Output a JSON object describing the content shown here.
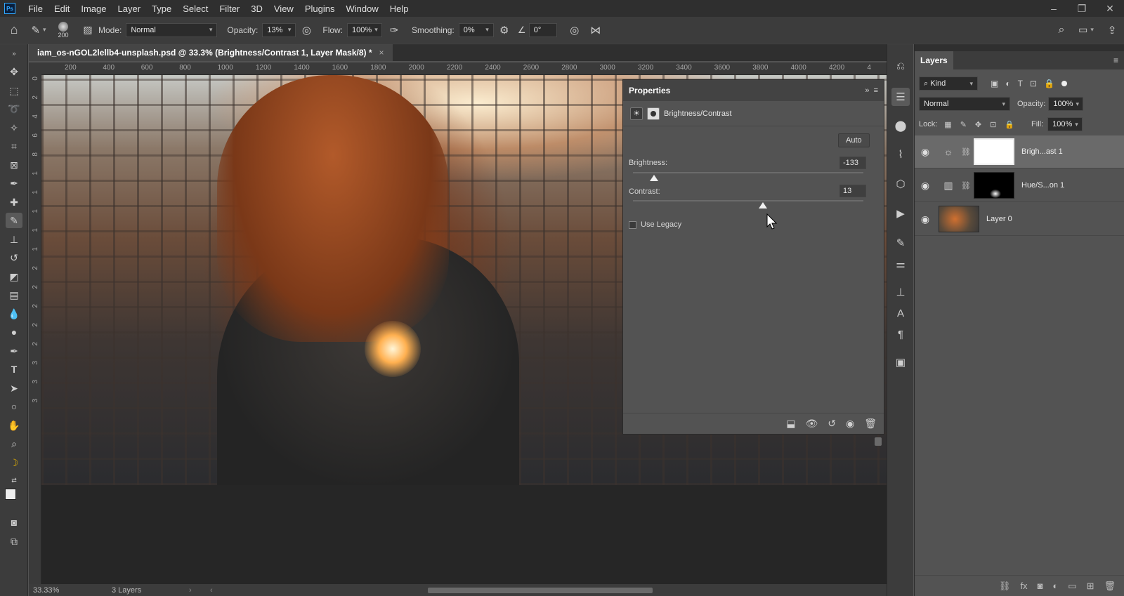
{
  "menubar": {
    "logo": "Ps",
    "items": [
      "File",
      "Edit",
      "Image",
      "Layer",
      "Type",
      "Select",
      "Filter",
      "3D",
      "View",
      "Plugins",
      "Window",
      "Help"
    ]
  },
  "options": {
    "brush_size": "200",
    "mode_label": "Mode:",
    "mode_value": "Normal",
    "opacity_label": "Opacity:",
    "opacity_value": "13%",
    "flow_label": "Flow:",
    "flow_value": "100%",
    "smoothing_label": "Smoothing:",
    "smoothing_value": "0%",
    "angle_value": "0°"
  },
  "document": {
    "tab_title": "iam_os-nGOL2lellb4-unsplash.psd @ 33.3% (Brightness/Contrast 1, Layer Mask/8) *",
    "close": "×"
  },
  "ruler": {
    "h_ticks": [
      "200",
      "400",
      "600",
      "800",
      "1000",
      "1200",
      "1400",
      "1600",
      "1800",
      "2000",
      "2200",
      "2400",
      "2600",
      "2800",
      "3000",
      "3200",
      "3400",
      "3600",
      "3800",
      "4000",
      "4200",
      "4"
    ],
    "v_ticks": [
      "0",
      "2",
      "4",
      "6",
      "8",
      "1",
      "1",
      "1",
      "1",
      "1",
      "2",
      "2",
      "2",
      "2",
      "2",
      "3",
      "3",
      "3"
    ]
  },
  "properties": {
    "title": "Properties",
    "adjustment_name": "Brightness/Contrast",
    "auto_label": "Auto",
    "brightness_label": "Brightness:",
    "brightness_value": "-133",
    "brightness_fraction": 0.09,
    "contrast_label": "Contrast:",
    "contrast_value": "13",
    "contrast_fraction": 0.563,
    "use_legacy_label": "Use Legacy"
  },
  "status": {
    "zoom": "33.33%",
    "info": "3 Layers"
  },
  "layers": {
    "title": "Layers",
    "filter_kind": "Kind",
    "blend_mode": "Normal",
    "opacity_label": "Opacity:",
    "opacity_value": "100%",
    "lock_label": "Lock:",
    "fill_label": "Fill:",
    "fill_value": "100%",
    "items": [
      {
        "name": "Brigh...ast 1"
      },
      {
        "name": "Hue/S...on 1"
      },
      {
        "name": "Layer 0"
      }
    ]
  },
  "colors": {
    "accent": "#31a8ff",
    "panel": "#535353",
    "dark": "#2f2f2f"
  }
}
